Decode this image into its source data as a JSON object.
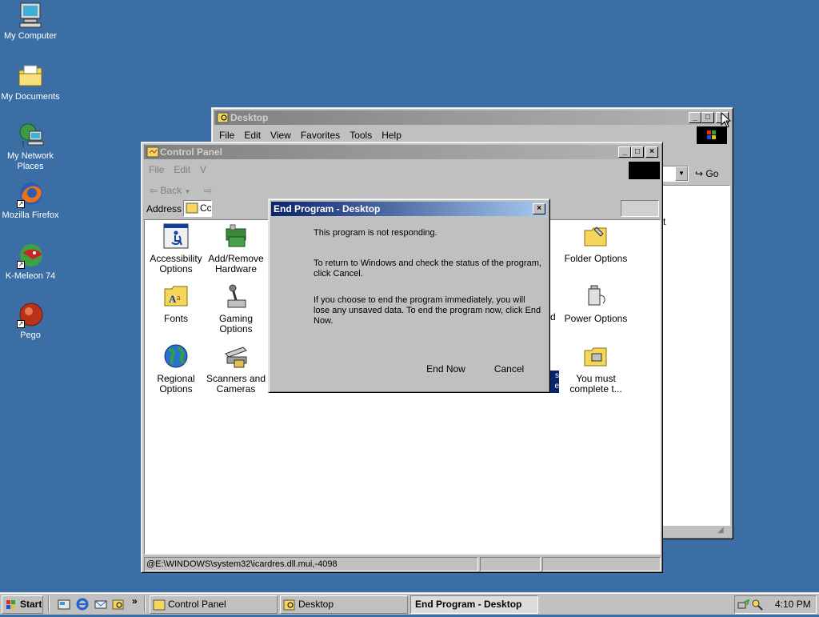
{
  "desktop": {
    "background": "#3a6ea5",
    "icons": [
      {
        "label": "My Computer",
        "icon": "computer-icon"
      },
      {
        "label": "My Documents",
        "icon": "folder-documents-icon"
      },
      {
        "label": "My Network Places",
        "icon": "network-places-icon"
      },
      {
        "label": "Mozilla Firefox",
        "icon": "firefox-icon"
      },
      {
        "label": "K-Meleon 74",
        "icon": "k-meleon-icon"
      },
      {
        "label": "Pego",
        "icon": "pego-icon"
      }
    ]
  },
  "desktop_window": {
    "title": "Desktop",
    "menu": [
      "File",
      "Edit",
      "View",
      "Favorites",
      "Tools",
      "Help"
    ],
    "go_label": "Go"
  },
  "control_panel": {
    "title": "Control Panel",
    "menu": [
      "File",
      "Edit",
      "V"
    ],
    "back_label": "Back",
    "address_label": "Address",
    "address_value": "Cc",
    "items": [
      {
        "label": "Accessibility Options",
        "icon": "accessibility-icon"
      },
      {
        "label": "Add/Remove Hardware",
        "icon": "hardware-icon"
      },
      {
        "label": "Folder Options",
        "icon": "folder-options-icon"
      },
      {
        "label": "Fonts",
        "icon": "fonts-icon"
      },
      {
        "label": "Gaming Options",
        "icon": "joystick-icon"
      },
      {
        "label": "Power Options",
        "icon": "power-icon"
      },
      {
        "label": "Regional Options",
        "icon": "globe-icon"
      },
      {
        "label": "Scanners and Cameras",
        "icon": "scanner-icon"
      },
      {
        "label": "You must complete t...",
        "icon": "setup-icon"
      }
    ],
    "partial_right": [
      "t",
      "d",
      "s",
      "e"
    ],
    "status_text": "@E:\\WINDOWS\\system32\\icardres.dll.mui,-4098"
  },
  "dialog": {
    "title": "End Program - Desktop",
    "line1": "This program is not responding.",
    "line2": "To return to Windows and check the status of the program, click Cancel.",
    "line3": "If you choose to end the program immediately, you will lose any unsaved data. To end the program now, click End Now.",
    "end_now": "End Now",
    "cancel": "Cancel"
  },
  "taskbar": {
    "start": "Start",
    "tasks": [
      {
        "label": "Control Panel",
        "active": false
      },
      {
        "label": "Desktop",
        "active": false
      },
      {
        "label": "End Program - Desktop",
        "active": true
      }
    ],
    "clock": "4:10 PM"
  }
}
